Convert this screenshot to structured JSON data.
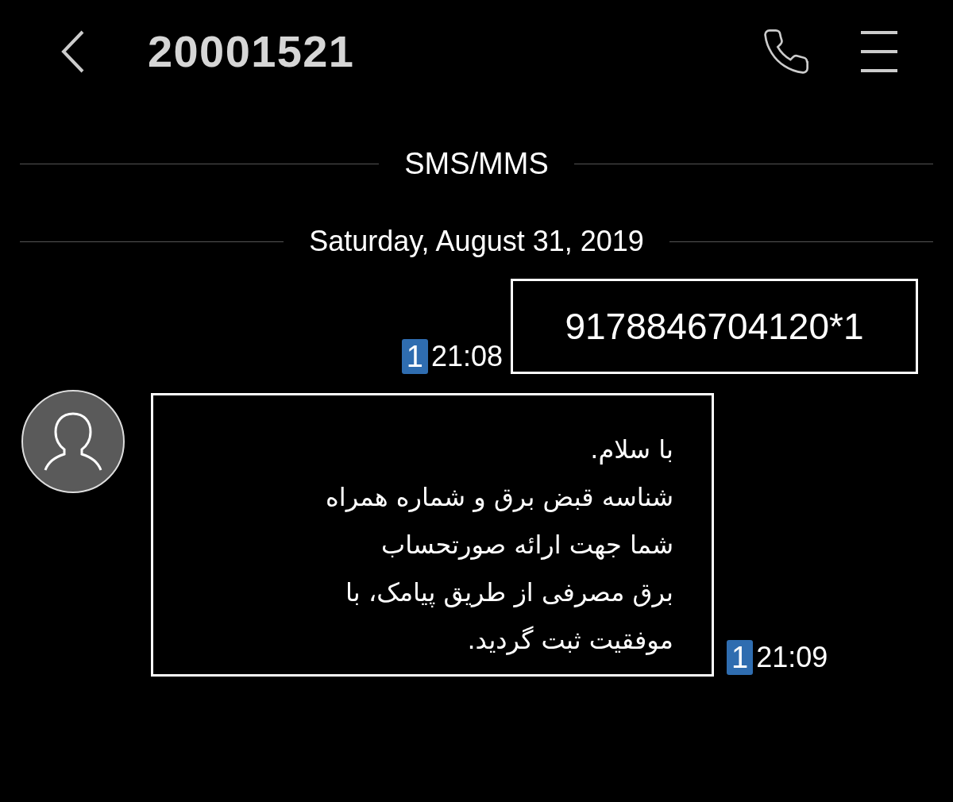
{
  "header": {
    "title": "20001521"
  },
  "channel_label": "SMS/MMS",
  "date_label": "Saturday, August 31, 2019",
  "messages": [
    {
      "kind": "sent",
      "text": "9178846704120*1",
      "sim": "1",
      "time": "21:08"
    },
    {
      "kind": "received",
      "text": "با سلام.\nشناسه قبض برق و شماره همراه\nشما جهت ارائه صورتحساب\nبرق مصرفی از طریق پیامک، با\nموفقیت ثبت گردید.",
      "sim": "1",
      "time": "21:09"
    }
  ]
}
